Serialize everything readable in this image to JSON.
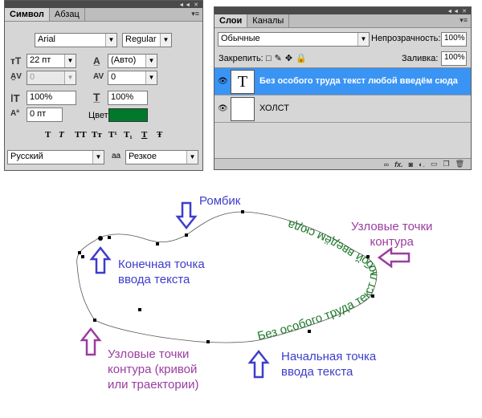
{
  "character_panel": {
    "tabs": [
      "Символ",
      "Абзац"
    ],
    "font_family": "Arial",
    "font_style": "Regular",
    "font_size": "22 пт",
    "leading": "(Авто)",
    "kerning": "0",
    "tracking": "0",
    "vertical_scale": "100%",
    "horizontal_scale": "100%",
    "baseline_shift": "0 пт",
    "color_label": "Цвет:",
    "color_swatch": "#007a2a",
    "format_buttons": [
      "T",
      "T",
      "TT",
      "Tт",
      "T¹",
      "T₁",
      "T",
      "Ŧ"
    ],
    "language": "Русский",
    "aa_label": "aa",
    "antialias": "Резкое"
  },
  "layers_panel": {
    "tabs": [
      "Слои",
      "Каналы"
    ],
    "blend_mode": "Обычные",
    "opacity_label": "Непрозрачность:",
    "opacity": "100%",
    "lock_label": "Закрепить:",
    "fill_label": "Заливка:",
    "fill": "100%",
    "layers": [
      {
        "name": "Без особого труда текст любой введём сюда",
        "thumb": "T",
        "selected": true
      },
      {
        "name": "ХОЛСТ",
        "thumb": "",
        "selected": false
      }
    ],
    "bottom_icons": [
      "link-icon",
      "fx-icon",
      "mask-icon",
      "adjustment-icon",
      "group-icon",
      "new-layer-icon",
      "trash-icon"
    ]
  },
  "annotations": {
    "rombik": "Ромбик",
    "end_point": [
      "Конечная точка",
      "ввода текста"
    ],
    "nodes_top": [
      "Узловые точки",
      "контура"
    ],
    "nodes_bottom": [
      "Узловые точки",
      "контура (кривой",
      "или траектории)"
    ],
    "start_point": [
      "Начальная точка",
      "ввода текста"
    ],
    "path_text": "Без особого труда текст любой введём сюда",
    "color_blue": "#3d3dcc",
    "color_purple": "#9a3da0",
    "color_text_green": "#1f7a2a"
  }
}
